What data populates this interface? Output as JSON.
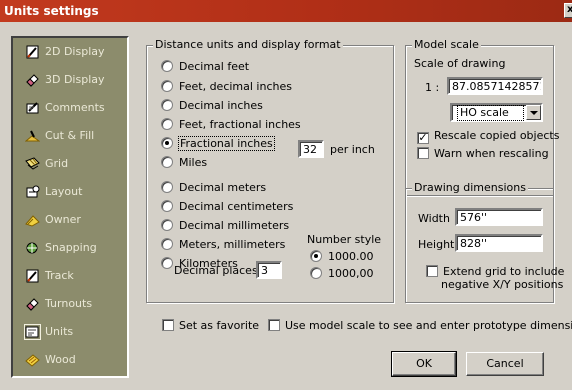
{
  "window": {
    "title": "Units settings",
    "close_glyph": "x"
  },
  "sidebar": {
    "items": [
      {
        "label": "2D Display",
        "icon": "pencil-icon",
        "selected": false
      },
      {
        "label": "3D Display",
        "icon": "eraser-icon",
        "selected": false
      },
      {
        "label": "Comments",
        "icon": "pen-icon",
        "selected": false
      },
      {
        "label": "Cut & Fill",
        "icon": "shovel-icon",
        "selected": false
      },
      {
        "label": "Grid",
        "icon": "grid-icon",
        "selected": false
      },
      {
        "label": "Layout",
        "icon": "layout-icon",
        "selected": false
      },
      {
        "label": "Owner",
        "icon": "owner-icon",
        "selected": false
      },
      {
        "label": "Snapping",
        "icon": "snapping-icon",
        "selected": false
      },
      {
        "label": "Track",
        "icon": "track-icon",
        "selected": false
      },
      {
        "label": "Turnouts",
        "icon": "turnout-icon",
        "selected": false
      },
      {
        "label": "Units",
        "icon": "units-icon",
        "selected": true
      },
      {
        "label": "Wood",
        "icon": "wood-icon",
        "selected": false
      }
    ]
  },
  "distance": {
    "title": "Distance units and display format",
    "options": [
      {
        "label": "Decimal feet",
        "checked": false
      },
      {
        "label": "Feet, decimal inches",
        "checked": false
      },
      {
        "label": "Decimal inches",
        "checked": false
      },
      {
        "label": "Feet, fractional inches",
        "checked": false
      },
      {
        "label": "Fractional inches",
        "checked": true
      },
      {
        "label": "Miles",
        "checked": false
      },
      {
        "label": "Decimal meters",
        "checked": false
      },
      {
        "label": "Decimal centimeters",
        "checked": false
      },
      {
        "label": "Decimal millimeters",
        "checked": false
      },
      {
        "label": "Meters, millimeters",
        "checked": false
      },
      {
        "label": "Kilometers",
        "checked": false
      }
    ],
    "per_inch_value": "32",
    "per_inch_label": "per inch",
    "decimal_places_label": "Decimal places",
    "decimal_places_value": "3",
    "number_style_label": "Number style",
    "number_styles": [
      {
        "label": "1000.00",
        "checked": true
      },
      {
        "label": "1000,00",
        "checked": false
      }
    ]
  },
  "model_scale": {
    "title": "Model scale",
    "scale_label": "Scale of drawing",
    "ratio_prefix": "1 :",
    "ratio_value": "87.08571428571",
    "scale_select": "HO scale",
    "rescale_copied": {
      "label": "Rescale copied objects",
      "checked": true
    },
    "warn_rescaling": {
      "label": "Warn when rescaling",
      "checked": false
    }
  },
  "drawing_dimensions": {
    "title": "Drawing dimensions",
    "width_label": "Width",
    "width_value": "576''",
    "height_label": "Height",
    "height_value": "828''",
    "extend_grid_line1": "Extend grid to include",
    "extend_grid_line2": "negative X/Y positions",
    "extend_grid_checked": false
  },
  "footer": {
    "set_favorite": {
      "label": "Set as favorite",
      "checked": false
    },
    "use_model_scale": {
      "label": "Use model scale to see and enter prototype dimensions",
      "checked": false
    },
    "ok_label": "OK",
    "cancel_label": "Cancel"
  },
  "colors": {
    "title_bar": "#c23a1e",
    "sidebar_bg": "#8c8c6c",
    "dialog_bg": "#d4d0c8"
  }
}
